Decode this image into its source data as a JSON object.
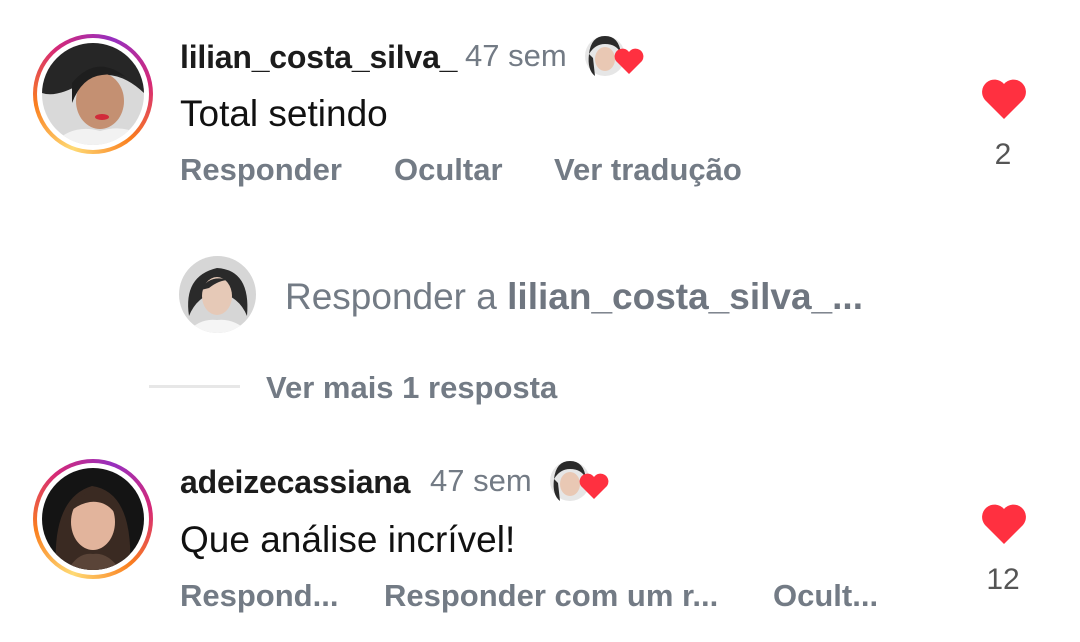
{
  "comments": [
    {
      "username": "lilian_costa_silva_",
      "time": "47 sem",
      "text": "Total setindo",
      "likes": "2",
      "actions": [
        "Responder",
        "Ocultar",
        "Ver tradução"
      ]
    },
    {
      "username": "adeizecassiana",
      "time": "47 sem",
      "text": "Que análise incrível!",
      "likes": "12",
      "actions": [
        "Respond...",
        "Responder com um r...",
        "Ocult..."
      ]
    }
  ],
  "reply_box": {
    "prefix": "Responder a",
    "target": "lilian_costa_silva_..."
  },
  "thread": {
    "view_more": "Ver mais 1 resposta"
  },
  "colors": {
    "heart": "#ff3040",
    "muted_text": "#737b85"
  },
  "icons": [
    "heart-icon",
    "creator-liked-icon",
    "avatar"
  ]
}
